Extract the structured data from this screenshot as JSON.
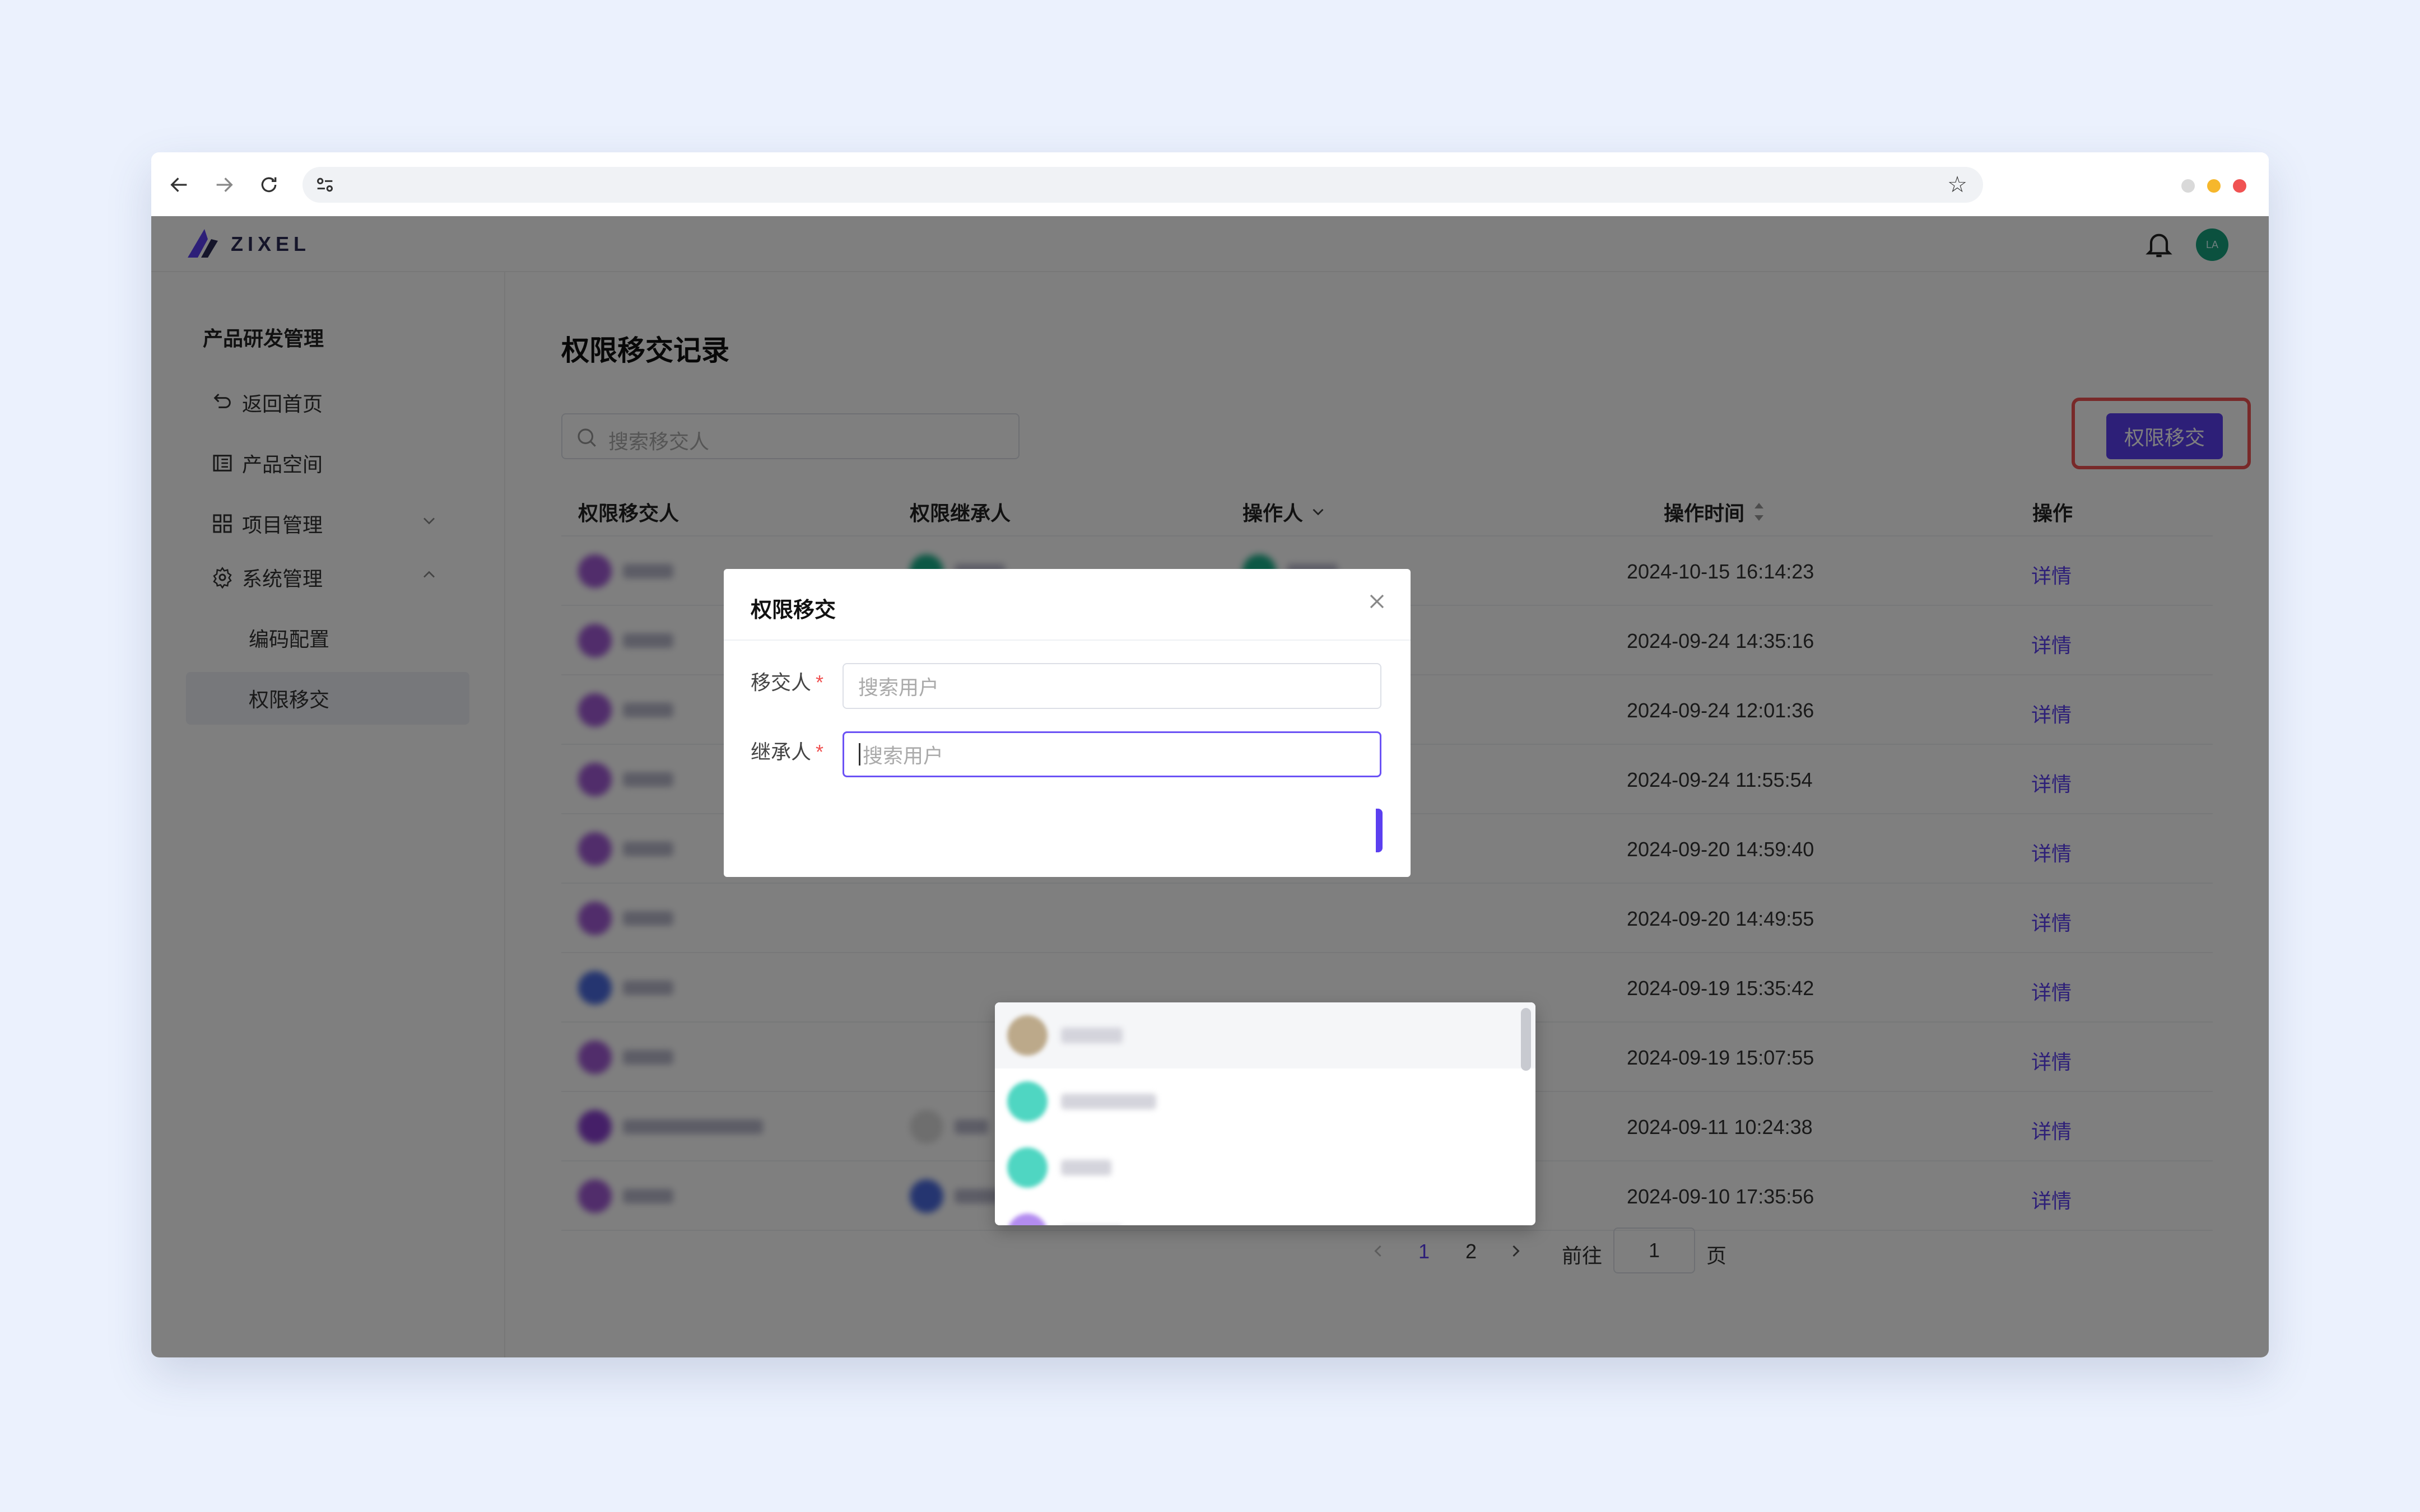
{
  "browser": {
    "url": "",
    "dot_colors": [
      "#d9d9d9",
      "#f6b72c",
      "#f05252"
    ]
  },
  "app": {
    "logo_text": "ZIXEL",
    "user_avatar": "LA",
    "accent_color": "#5b3ff0"
  },
  "sidebar": {
    "title": "产品研发管理",
    "items": [
      {
        "label": "返回首页",
        "icon": "back-icon"
      },
      {
        "label": "产品空间",
        "icon": "product-space-icon"
      },
      {
        "label": "项目管理",
        "icon": "grid-icon"
      },
      {
        "label": "系统管理",
        "icon": "gear-icon"
      },
      {
        "label": "编码配置"
      },
      {
        "label": "权限移交"
      }
    ]
  },
  "main": {
    "page_title": "权限移交记录",
    "search_placeholder": "搜索移交人",
    "transfer_button": "权限移交",
    "columns": [
      "权限移交人",
      "权限继承人",
      "操作人",
      "操作时间",
      "操作"
    ],
    "rows": [
      {
        "time": "2024-10-15 16:14:23",
        "action": "详情"
      },
      {
        "time": "2024-09-24 14:35:16",
        "action": "详情"
      },
      {
        "time": "2024-09-24 12:01:36",
        "action": "详情"
      },
      {
        "time": "2024-09-24 11:55:54",
        "action": "详情"
      },
      {
        "time": "2024-09-20 14:59:40",
        "action": "详情"
      },
      {
        "time": "2024-09-20 14:49:55",
        "action": "详情"
      },
      {
        "time": "2024-09-19 15:35:42",
        "action": "详情"
      },
      {
        "time": "2024-09-19 15:07:55",
        "action": "详情"
      },
      {
        "time": "2024-09-11 10:24:38",
        "action": "详情"
      },
      {
        "time": "2024-09-10 17:35:56",
        "action": "详情"
      }
    ],
    "pagination": {
      "pages": [
        "1",
        "2"
      ],
      "current": "1",
      "goto_label": "前往",
      "goto_value": "1",
      "page_suffix": "页"
    }
  },
  "modal": {
    "title": "权限移交",
    "transferor_label": "移交人",
    "transferor_placeholder": "搜索用户",
    "successor_label": "继承人",
    "successor_placeholder": "搜索用户"
  }
}
